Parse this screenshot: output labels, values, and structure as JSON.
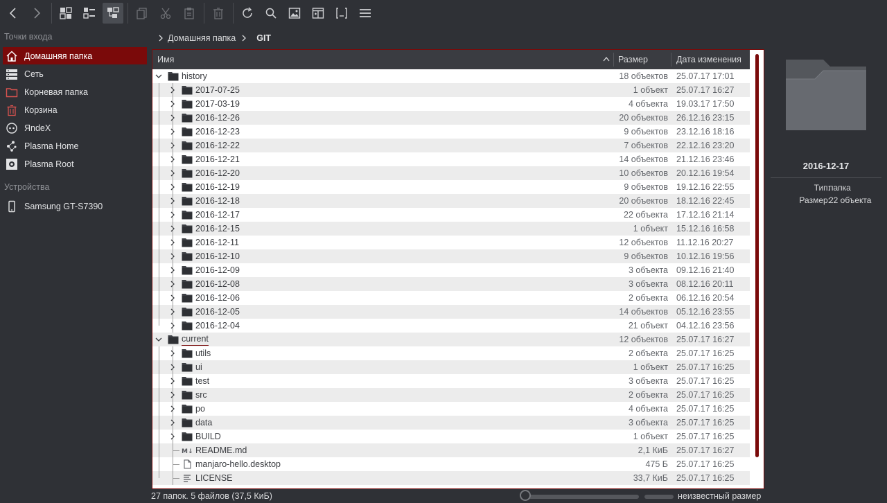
{
  "toolbar": {
    "back": "back-arrow",
    "forward": "forward-arrow",
    "views": [
      "icons-view",
      "details-view",
      "tree-view"
    ],
    "actions": [
      "copy",
      "cut",
      "paste",
      "delete",
      "reload",
      "search",
      "preview",
      "split",
      "terminal",
      "menu"
    ]
  },
  "sidebar": {
    "places_header": "Точки входа",
    "places": [
      {
        "label": "Домашняя папка",
        "icon": "home-icon",
        "selected": true
      },
      {
        "label": "Сеть",
        "icon": "network-icon"
      },
      {
        "label": "Корневая папка",
        "icon": "root-folder-icon"
      },
      {
        "label": "Корзина",
        "icon": "trash-icon"
      },
      {
        "label": "ЯndeX",
        "icon": "yandex-icon"
      },
      {
        "label": "Plasma Home",
        "icon": "plasma-icon"
      },
      {
        "label": "Plasma Root",
        "icon": "plasma-root-icon"
      }
    ],
    "devices_header": "Устройства",
    "devices": [
      {
        "label": "Samsung GT-S7390",
        "icon": "phone-icon"
      }
    ]
  },
  "breadcrumb": {
    "parent": "Домашняя папка",
    "current": "GIT"
  },
  "columns": {
    "name": "Имя",
    "size": "Размер",
    "date": "Дата изменения"
  },
  "rows": [
    {
      "level": 0,
      "type": "folder",
      "expanded": true,
      "name": "history",
      "size": "18 объектов",
      "date": "25.07.17 17:01"
    },
    {
      "level": 1,
      "type": "folder",
      "name": "2017-07-25",
      "size": "1 объект",
      "date": "25.07.17 16:27"
    },
    {
      "level": 1,
      "type": "folder",
      "name": "2017-03-19",
      "size": "4 объекта",
      "date": "19.03.17 17:50"
    },
    {
      "level": 1,
      "type": "folder",
      "name": "2016-12-26",
      "size": "20 объектов",
      "date": "26.12.16 23:15"
    },
    {
      "level": 1,
      "type": "folder",
      "name": "2016-12-23",
      "size": "9 объектов",
      "date": "23.12.16 18:16"
    },
    {
      "level": 1,
      "type": "folder",
      "name": "2016-12-22",
      "size": "7 объектов",
      "date": "22.12.16 23:20"
    },
    {
      "level": 1,
      "type": "folder",
      "name": "2016-12-21",
      "size": "14 объектов",
      "date": "21.12.16 23:46"
    },
    {
      "level": 1,
      "type": "folder",
      "name": "2016-12-20",
      "size": "10 объектов",
      "date": "20.12.16 19:54"
    },
    {
      "level": 1,
      "type": "folder",
      "name": "2016-12-19",
      "size": "9 объектов",
      "date": "19.12.16 22:55"
    },
    {
      "level": 1,
      "type": "folder",
      "name": "2016-12-18",
      "size": "20 объектов",
      "date": "18.12.16 22:45"
    },
    {
      "level": 1,
      "type": "folder",
      "name": "2016-12-17",
      "size": "22 объекта",
      "date": "17.12.16 21:14"
    },
    {
      "level": 1,
      "type": "folder",
      "name": "2016-12-15",
      "size": "1 объект",
      "date": "15.12.16 16:58"
    },
    {
      "level": 1,
      "type": "folder",
      "name": "2016-12-11",
      "size": "12 объектов",
      "date": "11.12.16 20:27"
    },
    {
      "level": 1,
      "type": "folder",
      "name": "2016-12-10",
      "size": "9 объектов",
      "date": "10.12.16 19:56"
    },
    {
      "level": 1,
      "type": "folder",
      "name": "2016-12-09",
      "size": "3 объекта",
      "date": "09.12.16 21:40"
    },
    {
      "level": 1,
      "type": "folder",
      "name": "2016-12-08",
      "size": "3 объекта",
      "date": "08.12.16 20:11"
    },
    {
      "level": 1,
      "type": "folder",
      "name": "2016-12-06",
      "size": "2 объекта",
      "date": "06.12.16 20:54"
    },
    {
      "level": 1,
      "type": "folder",
      "name": "2016-12-05",
      "size": "14 объектов",
      "date": "05.12.16 23:55"
    },
    {
      "level": 1,
      "type": "folder",
      "name": "2016-12-04",
      "size": "21 объект",
      "date": "04.12.16 23:56"
    },
    {
      "level": 0,
      "type": "folder",
      "expanded": true,
      "underline": true,
      "name": "current",
      "size": "12 объектов",
      "date": "25.07.17 16:27"
    },
    {
      "level": 1,
      "type": "folder",
      "name": "utils",
      "size": "2 объекта",
      "date": "25.07.17 16:25"
    },
    {
      "level": 1,
      "type": "folder",
      "name": "ui",
      "size": "1 объект",
      "date": "25.07.17 16:25"
    },
    {
      "level": 1,
      "type": "folder",
      "name": "test",
      "size": "3 объекта",
      "date": "25.07.17 16:25"
    },
    {
      "level": 1,
      "type": "folder",
      "name": "src",
      "size": "2 объекта",
      "date": "25.07.17 16:25"
    },
    {
      "level": 1,
      "type": "folder",
      "name": "po",
      "size": "4 объекта",
      "date": "25.07.17 16:25"
    },
    {
      "level": 1,
      "type": "folder",
      "name": "data",
      "size": "3 объекта",
      "date": "25.07.17 16:25"
    },
    {
      "level": 1,
      "type": "folder",
      "name": "BUILD",
      "size": "1 объект",
      "date": "25.07.17 16:25"
    },
    {
      "level": 1,
      "type": "markdown",
      "name": "README.md",
      "size": "2,1 КиБ",
      "date": "25.07.17 16:27"
    },
    {
      "level": 1,
      "type": "file",
      "name": "manjaro-hello.desktop",
      "size": "475 Б",
      "date": "25.07.17 16:25"
    },
    {
      "level": 1,
      "type": "text",
      "name": "LICENSE",
      "size": "33,7 КиБ",
      "date": "25.07.17 16:25"
    }
  ],
  "info": {
    "name": "2016-12-17",
    "type_label": "Тип:",
    "type_value": "папка",
    "size_label": "Размер:",
    "size_value": "22 объекта"
  },
  "status": {
    "summary": "27 папок. 5 файлов (37,5 КиБ)",
    "zoom_fraction": 0.0,
    "space_label": "неизвестный размер"
  },
  "colors": {
    "accent": "#7a0a0a",
    "bg": "#2f3136",
    "header": "#3a3c41"
  }
}
